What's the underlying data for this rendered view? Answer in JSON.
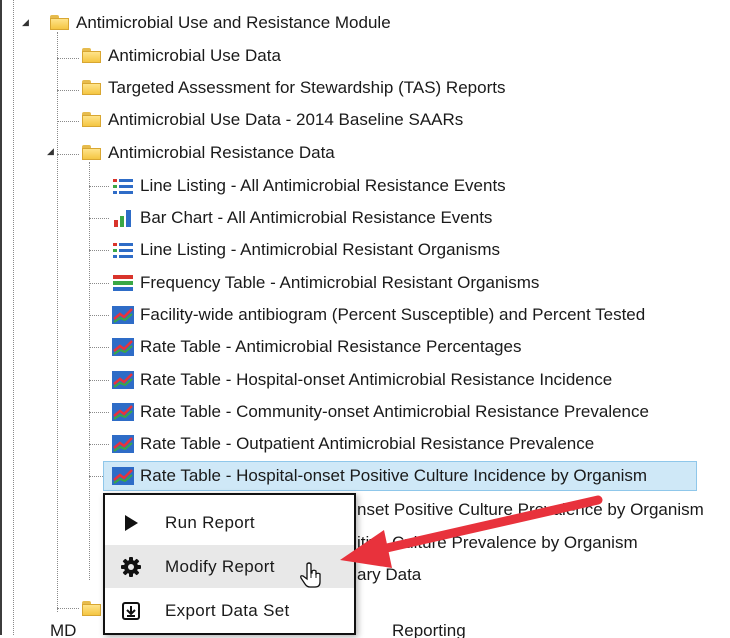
{
  "tree": {
    "root_folder": "Antimicrobial Use and Resistance Module",
    "folders": [
      "Antimicrobial Use Data",
      "Targeted Assessment for Stewardship (TAS) Reports",
      "Antimicrobial Use Data - 2014 Baseline SAARs",
      "Antimicrobial Resistance Data"
    ],
    "reports": [
      {
        "label": "Line Listing - All Antimicrobial Resistance Events",
        "icon": "line-listing-icon"
      },
      {
        "label": "Bar Chart - All Antimicrobial Resistance Events",
        "icon": "bar-chart-icon"
      },
      {
        "label": "Line Listing - Antimicrobial Resistant Organisms",
        "icon": "line-listing-icon"
      },
      {
        "label": "Frequency Table - Antimicrobial Resistant Organisms",
        "icon": "frequency-table-icon"
      },
      {
        "label": "Facility-wide antibiogram (Percent Susceptible) and Percent Tested",
        "icon": "rate-table-icon"
      },
      {
        "label": "Rate Table - Antimicrobial Resistance Percentages",
        "icon": "rate-table-icon"
      },
      {
        "label": "Rate Table - Hospital-onset Antimicrobial Resistance Incidence",
        "icon": "rate-table-icon"
      },
      {
        "label": "Rate Table - Community-onset Antimicrobial Resistance Prevalence",
        "icon": "rate-table-icon"
      },
      {
        "label": "Rate Table - Outpatient Antimicrobial Resistance Prevalence",
        "icon": "rate-table-icon"
      },
      {
        "label": "Rate Table - Hospital-onset Positive Culture Incidence by Organism",
        "icon": "rate-table-icon"
      }
    ],
    "partial_items": [
      "nset Positive Culture Prevalence by Organism",
      "itive Culture Prevalence by Organism",
      "ary Data"
    ],
    "bottom_partial": "MD",
    "bottom_partial_right": "Reporting"
  },
  "context_menu": {
    "items": [
      {
        "label": "Run Report",
        "icon": "play-icon"
      },
      {
        "label": "Modify Report",
        "icon": "gear-icon"
      },
      {
        "label": "Export Data Set",
        "icon": "export-icon"
      }
    ]
  },
  "colors": {
    "selection": "#cfe8f7",
    "arrow": "#e8323c",
    "folder": "#f4c542"
  }
}
